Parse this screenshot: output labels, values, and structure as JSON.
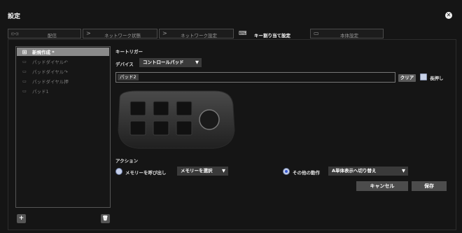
{
  "window": {
    "title": "設定",
    "close_glyph": "✕"
  },
  "tabs": [
    {
      "label": "配信",
      "icon": "broadcast-icon",
      "glyph": "((•))"
    },
    {
      "label": "ネットワーク状態",
      "icon": "chevron-right-icon",
      "glyph": ">"
    },
    {
      "label": "ネットワーク設定",
      "icon": "chevron-right-icon",
      "glyph": ">"
    },
    {
      "label": "キー割り当て設定",
      "icon": "keyboard-icon",
      "glyph": "⌨",
      "active": true
    },
    {
      "label": "本体設定",
      "icon": "device-icon",
      "glyph": "▭"
    }
  ],
  "sidebar": {
    "items": [
      {
        "label": "新規作成 *",
        "icon": "new-item-icon",
        "glyph": "⊞",
        "selected": true
      },
      {
        "label": "パッドダイヤル↶",
        "icon": "pad-icon",
        "glyph": "▭"
      },
      {
        "label": "パッドダイヤル↷",
        "icon": "pad-icon",
        "glyph": "▭"
      },
      {
        "label": "パッドダイヤル押",
        "icon": "pad-icon",
        "glyph": "▭"
      },
      {
        "label": "パッド1",
        "icon": "pad-icon",
        "glyph": "▭"
      }
    ],
    "add_glyph": "+",
    "delete_glyph": "🗑"
  },
  "trigger": {
    "section_label": "キートリガー",
    "device_label": "デバイス",
    "device_value": "コントロールパッド",
    "dropdown_arrow": "▼",
    "key_value": "パッド2",
    "clear_label": "クリア",
    "long_press_label": "長押し",
    "long_press_checked": false
  },
  "action": {
    "section_label": "アクション",
    "option1_label": "メモリーを呼び出し",
    "option1_selected": false,
    "memory_dropdown": "メモリーを選択",
    "option2_label": "その他の動作",
    "option2_selected": true,
    "other_dropdown": "A単体表示へ切り替え"
  },
  "buttons": {
    "cancel": "キャンセル",
    "save": "保存"
  },
  "colors": {
    "background": "#151515",
    "selected_item": "#8a8a8a",
    "button": "#4c4c4c",
    "radio_accent": "#3a5bd0"
  }
}
